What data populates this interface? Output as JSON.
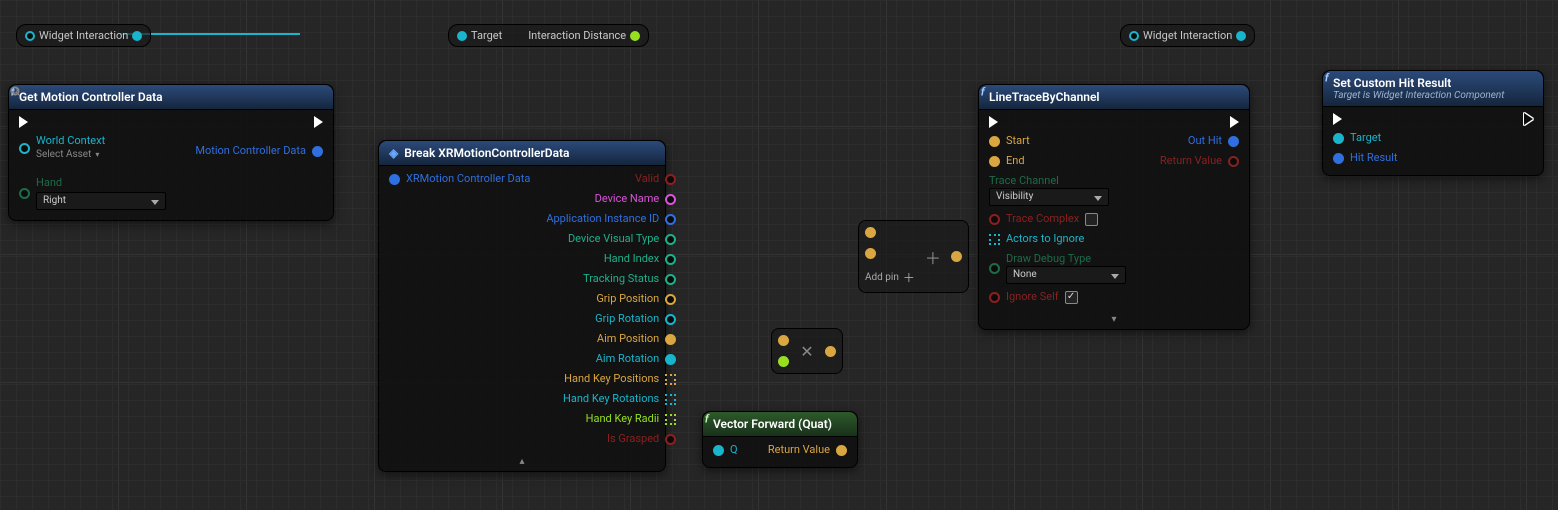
{
  "nodes": {
    "widget_reroute_1": {
      "label": "Widget Interaction"
    },
    "widget_reroute_2": {
      "label": "Widget Interaction"
    },
    "target_reroute": {
      "left": "Target",
      "right": "Interaction Distance"
    },
    "get_motion": {
      "title": "Get Motion Controller Data",
      "in": {
        "world_context": "World Context",
        "select_asset": "Select Asset",
        "hand": "Hand",
        "hand_value": "Right"
      },
      "out": {
        "motion_data": "Motion Controller Data"
      }
    },
    "break_xr": {
      "title": "Break XRMotionControllerData",
      "in": {
        "xrdata": "XRMotion Controller Data"
      },
      "out": [
        "Valid",
        "Device Name",
        "Application Instance ID",
        "Device Visual Type",
        "Hand Index",
        "Tracking Status",
        "Grip Position",
        "Grip Rotation",
        "Aim Position",
        "Aim Rotation",
        "Hand Key Positions",
        "Hand Key Rotations",
        "Hand Key Radii",
        "Is Grasped"
      ]
    },
    "vector_forward": {
      "title": "Vector Forward (Quat)",
      "in": "Q",
      "out": "Return Value"
    },
    "plus": {
      "addpin": "Add pin"
    },
    "mult": {},
    "line_trace": {
      "title": "LineTraceByChannel",
      "in": {
        "start": "Start",
        "end": "End",
        "trace_channel": "Trace Channel",
        "trace_channel_value": "Visibility",
        "trace_complex": "Trace Complex",
        "actors": "Actors to Ignore",
        "draw_debug": "Draw Debug Type",
        "draw_debug_value": "None",
        "ignore_self": "Ignore Self"
      },
      "out": {
        "out_hit": "Out Hit",
        "return_value": "Return Value"
      }
    },
    "set_hit": {
      "title": "Set Custom Hit Result",
      "subtitle": "Target is Widget Interaction Component",
      "in": {
        "target": "Target",
        "hit_result": "Hit Result"
      }
    }
  }
}
